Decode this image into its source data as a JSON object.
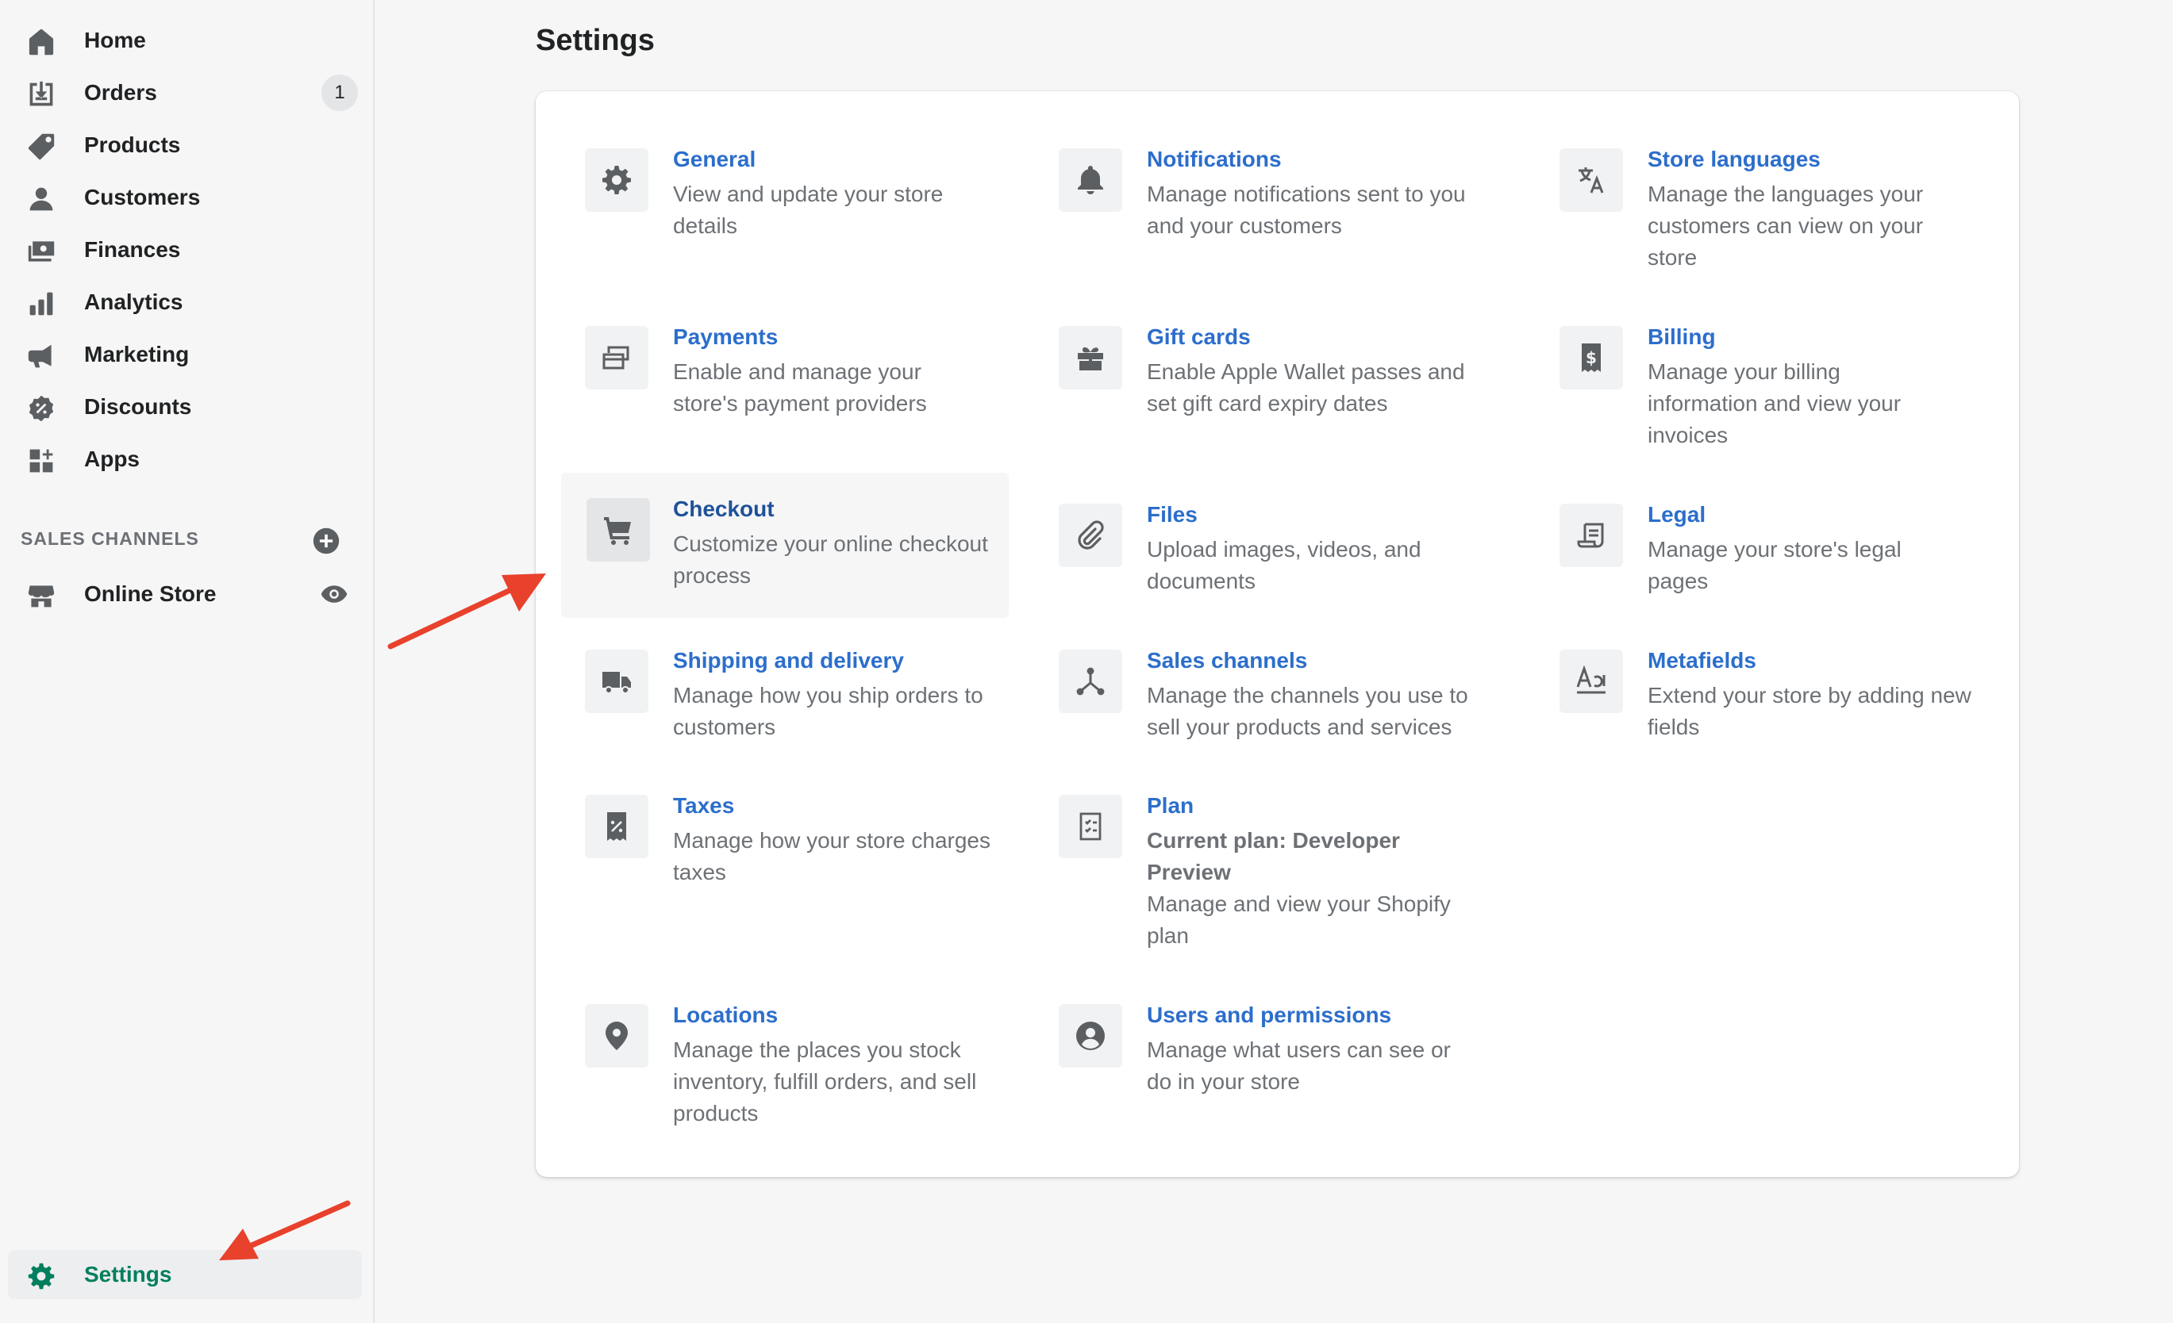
{
  "sidebar": {
    "items": [
      {
        "label": "Home",
        "icon": "home-icon"
      },
      {
        "label": "Orders",
        "icon": "orders-icon",
        "badge": "1"
      },
      {
        "label": "Products",
        "icon": "tag-icon"
      },
      {
        "label": "Customers",
        "icon": "person-icon"
      },
      {
        "label": "Finances",
        "icon": "finances-icon"
      },
      {
        "label": "Analytics",
        "icon": "bar-chart-icon"
      },
      {
        "label": "Marketing",
        "icon": "megaphone-icon"
      },
      {
        "label": "Discounts",
        "icon": "discount-icon"
      },
      {
        "label": "Apps",
        "icon": "apps-icon"
      }
    ],
    "sales_channels_heading": "SALES CHANNELS",
    "online_store_label": "Online Store",
    "settings_label": "Settings"
  },
  "page": {
    "title": "Settings"
  },
  "settings": [
    {
      "title": "General",
      "desc": "View and update your store details",
      "icon": "gear-icon"
    },
    {
      "title": "Notifications",
      "desc": "Manage notifications sent to you and your customers",
      "icon": "bell-icon"
    },
    {
      "title": "Store languages",
      "desc": "Manage the languages your customers can view on your store",
      "icon": "translate-icon"
    },
    {
      "title": "Payments",
      "desc": "Enable and manage your store's payment providers",
      "icon": "payments-icon"
    },
    {
      "title": "Gift cards",
      "desc": "Enable Apple Wallet passes and set gift card expiry dates",
      "icon": "gift-icon"
    },
    {
      "title": "Billing",
      "desc": "Manage your billing information and view your invoices",
      "icon": "billing-icon"
    },
    {
      "title": "Checkout",
      "desc": "Customize your online checkout process",
      "icon": "cart-icon"
    },
    {
      "title": "Files",
      "desc": "Upload images, videos, and documents",
      "icon": "paperclip-icon"
    },
    {
      "title": "Legal",
      "desc": "Manage your store's legal pages",
      "icon": "legal-icon"
    },
    {
      "title": "Shipping and delivery",
      "desc": "Manage how you ship orders to customers",
      "icon": "truck-icon"
    },
    {
      "title": "Sales channels",
      "desc": "Manage the channels you use to sell your products and services",
      "icon": "channels-icon"
    },
    {
      "title": "Metafields",
      "desc": "Extend your store by adding new fields",
      "icon": "metafields-icon"
    },
    {
      "title": "Taxes",
      "desc": "Manage how your store charges taxes",
      "icon": "taxes-icon"
    },
    {
      "title": "Plan",
      "plan_current": "Current plan: Developer Preview",
      "desc": "Manage and view your Shopify plan",
      "icon": "plan-icon"
    },
    {
      "title": "Locations",
      "desc": "Manage the places you stock inventory, fulfill orders, and sell products",
      "icon": "location-pin-icon"
    },
    {
      "title": "Users and permissions",
      "desc": "Manage what users can see or do in your store",
      "icon": "user-circle-icon"
    }
  ],
  "colors": {
    "link": "#2c6ecb",
    "active_nav": "#007f5f",
    "annotation_arrow": "#e8412c"
  }
}
